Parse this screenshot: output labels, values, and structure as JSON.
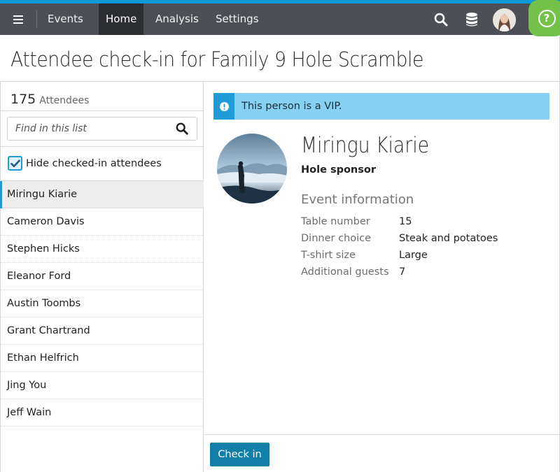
{
  "nav": {
    "events": "Events",
    "home": "Home",
    "analysis": "Analysis",
    "settings": "Settings",
    "accent_color": "#0d9ad8",
    "bar_color": "#4c4f56",
    "help_color": "#73c04b",
    "help_glyph": "?"
  },
  "page": {
    "title": "Attendee check-in for Family 9 Hole Scramble"
  },
  "sidebar": {
    "attendee_count": "175",
    "attendee_label": "Attendees",
    "search_placeholder": "Find in this list",
    "hide_checked_in_label": "Hide checked-in attendees",
    "hide_checked_in": true,
    "attendees": [
      {
        "name": "Miringu Kiarie",
        "selected": true
      },
      {
        "name": "Cameron Davis"
      },
      {
        "name": "Stephen Hicks"
      },
      {
        "name": "Eleanor Ford"
      },
      {
        "name": "Austin Toombs"
      },
      {
        "name": "Grant Chartrand"
      },
      {
        "name": "Ethan Helfrich"
      },
      {
        "name": "Jing You"
      },
      {
        "name": "Jeff Wain"
      }
    ]
  },
  "detail": {
    "vip_message": "This person is a VIP.",
    "name": "Miringu Kiarie",
    "role": "Hole sponsor",
    "event_info_heading": "Event information",
    "fields": [
      {
        "label": "Table number",
        "value": "15"
      },
      {
        "label": "Dinner choice",
        "value": "Steak and potatoes"
      },
      {
        "label": "T-shirt size",
        "value": "Large"
      },
      {
        "label": "Additional guests",
        "value": "7"
      }
    ]
  },
  "footer": {
    "check_in_label": "Check in",
    "button_color": "#117fa8"
  }
}
